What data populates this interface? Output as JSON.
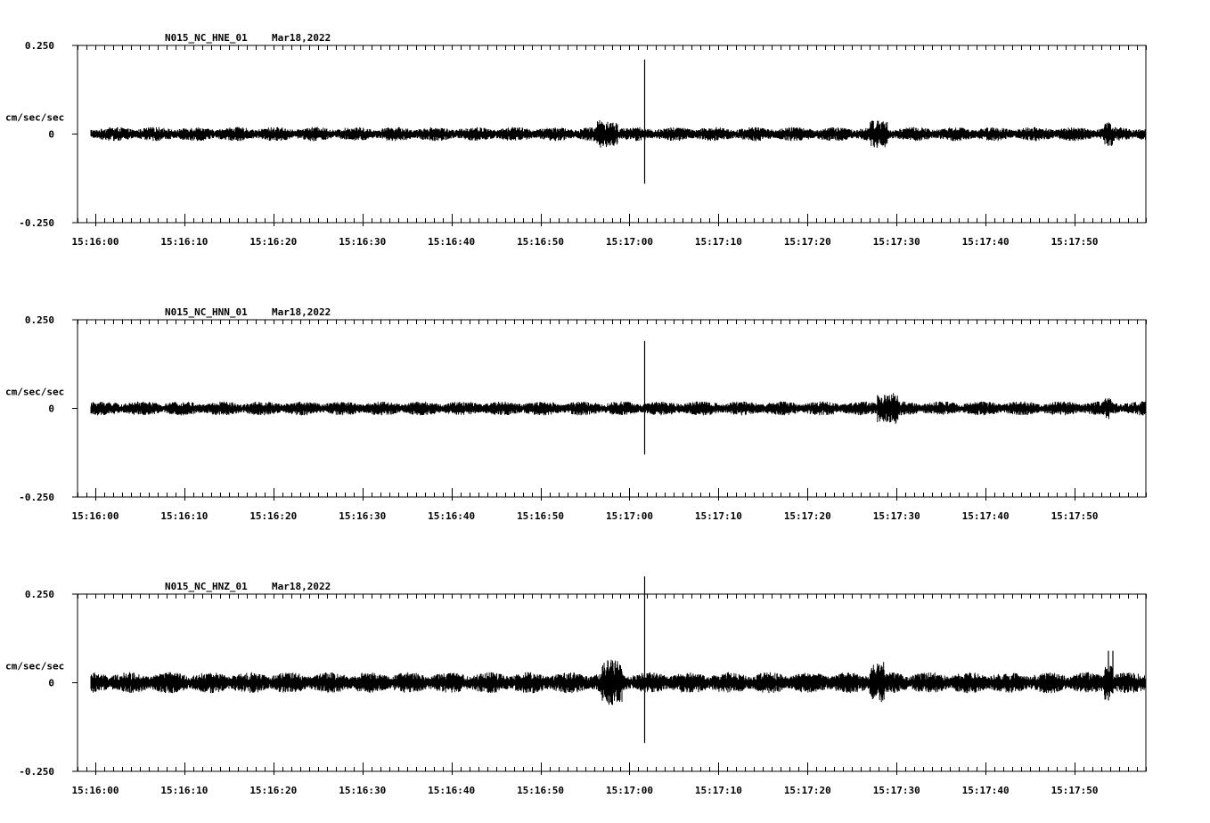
{
  "chart_data": [
    {
      "type": "line",
      "title": "N015_NC_HNE_01",
      "date": "Mar18,2022",
      "ylabel": "cm/sec/sec",
      "ylim": [
        -0.25,
        0.25
      ],
      "yticks": [
        "0.250",
        "0",
        "-0.250"
      ],
      "xlabels": [
        "15:16:00",
        "15:16:10",
        "15:16:20",
        "15:16:30",
        "15:16:40",
        "15:16:50",
        "15:17:00",
        "15:17:10",
        "15:17:20",
        "15:17:30",
        "15:17:40",
        "15:17:50"
      ],
      "xlim_seconds": [
        -2,
        118
      ],
      "trace_start_seconds": -0.5,
      "noise_amplitude": 0.02,
      "bursts": [
        {
          "t": 57.5,
          "amp": 0.022,
          "width": 1.2
        },
        {
          "t": 88.0,
          "amp": 0.02,
          "width": 1.0
        },
        {
          "t": 113.8,
          "amp": 0.015,
          "width": 0.5
        }
      ],
      "spikes": [
        {
          "t": 61.7,
          "hi": 0.21,
          "lo": -0.14
        }
      ]
    },
    {
      "type": "line",
      "title": "N015_NC_HNN_01",
      "date": "Mar18,2022",
      "ylabel": "cm/sec/sec",
      "ylim": [
        -0.25,
        0.25
      ],
      "yticks": [
        "0.250",
        "0",
        "-0.250"
      ],
      "xlabels": [
        "15:16:00",
        "15:16:10",
        "15:16:20",
        "15:16:30",
        "15:16:40",
        "15:16:50",
        "15:17:00",
        "15:17:10",
        "15:17:20",
        "15:17:30",
        "15:17:40",
        "15:17:50"
      ],
      "xlim_seconds": [
        -2,
        118
      ],
      "trace_start_seconds": -0.5,
      "noise_amplitude": 0.02,
      "bursts": [
        {
          "t": 89.0,
          "amp": 0.025,
          "width": 1.2
        },
        {
          "t": 113.8,
          "amp": 0.012,
          "width": 0.4
        }
      ],
      "spikes": [
        {
          "t": 61.7,
          "hi": 0.19,
          "lo": -0.13
        }
      ]
    },
    {
      "type": "line",
      "title": "N015_NC_HNZ_01",
      "date": "Mar18,2022",
      "ylabel": "cm/sec/sec",
      "ylim": [
        -0.25,
        0.25
      ],
      "yticks": [
        "0.250",
        "0",
        "-0.250"
      ],
      "xlabels": [
        "15:16:00",
        "15:16:10",
        "15:16:20",
        "15:16:30",
        "15:16:40",
        "15:16:50",
        "15:17:00",
        "15:17:10",
        "15:17:20",
        "15:17:30",
        "15:17:40",
        "15:17:50"
      ],
      "xlim_seconds": [
        -2,
        118
      ],
      "trace_start_seconds": -0.5,
      "noise_amplitude": 0.03,
      "bursts": [
        {
          "t": 58.0,
          "amp": 0.035,
          "width": 1.2
        },
        {
          "t": 87.8,
          "amp": 0.03,
          "width": 0.8
        },
        {
          "t": 113.8,
          "amp": 0.03,
          "width": 0.5
        }
      ],
      "spikes": [
        {
          "t": 61.7,
          "hi": 0.3,
          "lo": -0.17
        },
        {
          "t": 113.8,
          "hi": 0.09,
          "lo": -0.05
        },
        {
          "t": 114.3,
          "hi": 0.09,
          "lo": -0.03
        }
      ]
    }
  ]
}
